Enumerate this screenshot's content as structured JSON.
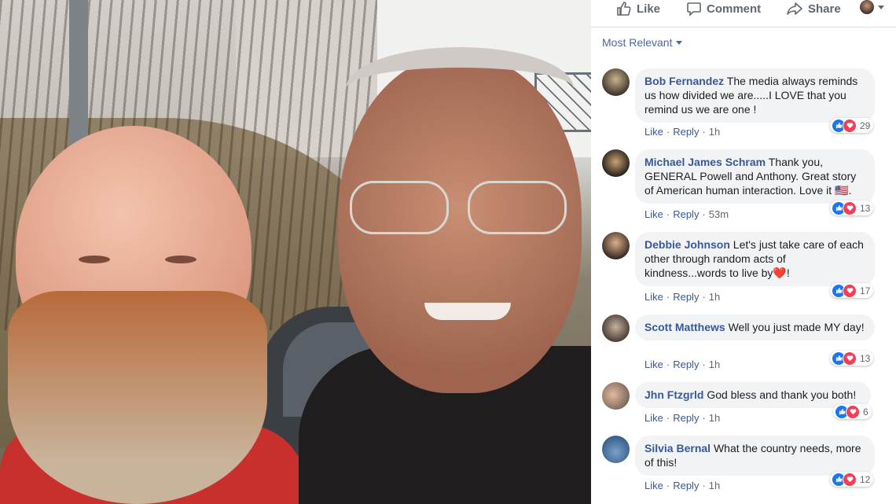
{
  "actions": {
    "like": "Like",
    "comment": "Comment",
    "share": "Share"
  },
  "sort": {
    "label": "Most Relevant"
  },
  "comment_meta": {
    "like": "Like",
    "reply": "Reply",
    "separator": "·"
  },
  "comments": [
    {
      "author": "Bob Fernandez",
      "text": "The media always reminds us how divided we are.....I LOVE that you remind us we are one !",
      "time": "1h",
      "reactions": "29"
    },
    {
      "author": "Michael James Schram",
      "text": "Thank you, GENERAL Powell and Anthony. Great story of American human interaction. Love it 🇺🇸.",
      "time": "53m",
      "reactions": "13"
    },
    {
      "author": "Debbie Johnson",
      "text": "Let's just take care of each other through random acts of kindness...words to live by❤️!",
      "time": "1h",
      "reactions": "17"
    },
    {
      "author": "Scott Matthews",
      "text": "Well you just made MY day!",
      "time": "1h",
      "reactions": "13"
    },
    {
      "author": "Jhn Ftzgrld",
      "text": "God bless and thank you both!",
      "time": "1h",
      "reactions": "6"
    },
    {
      "author": "Silvia Bernal",
      "text": "What the country needs, more of this!",
      "time": "1h",
      "reactions": "12"
    }
  ],
  "icons": {
    "like": "thumbs-up-icon",
    "comment": "speech-bubble-icon",
    "share": "share-arrow-icon",
    "reaction_like": "like-reaction-icon",
    "reaction_love": "love-reaction-icon"
  },
  "colors": {
    "link": "#385898",
    "bubble": "#f2f3f5",
    "like": "#1877f2",
    "love": "#f33e58"
  }
}
